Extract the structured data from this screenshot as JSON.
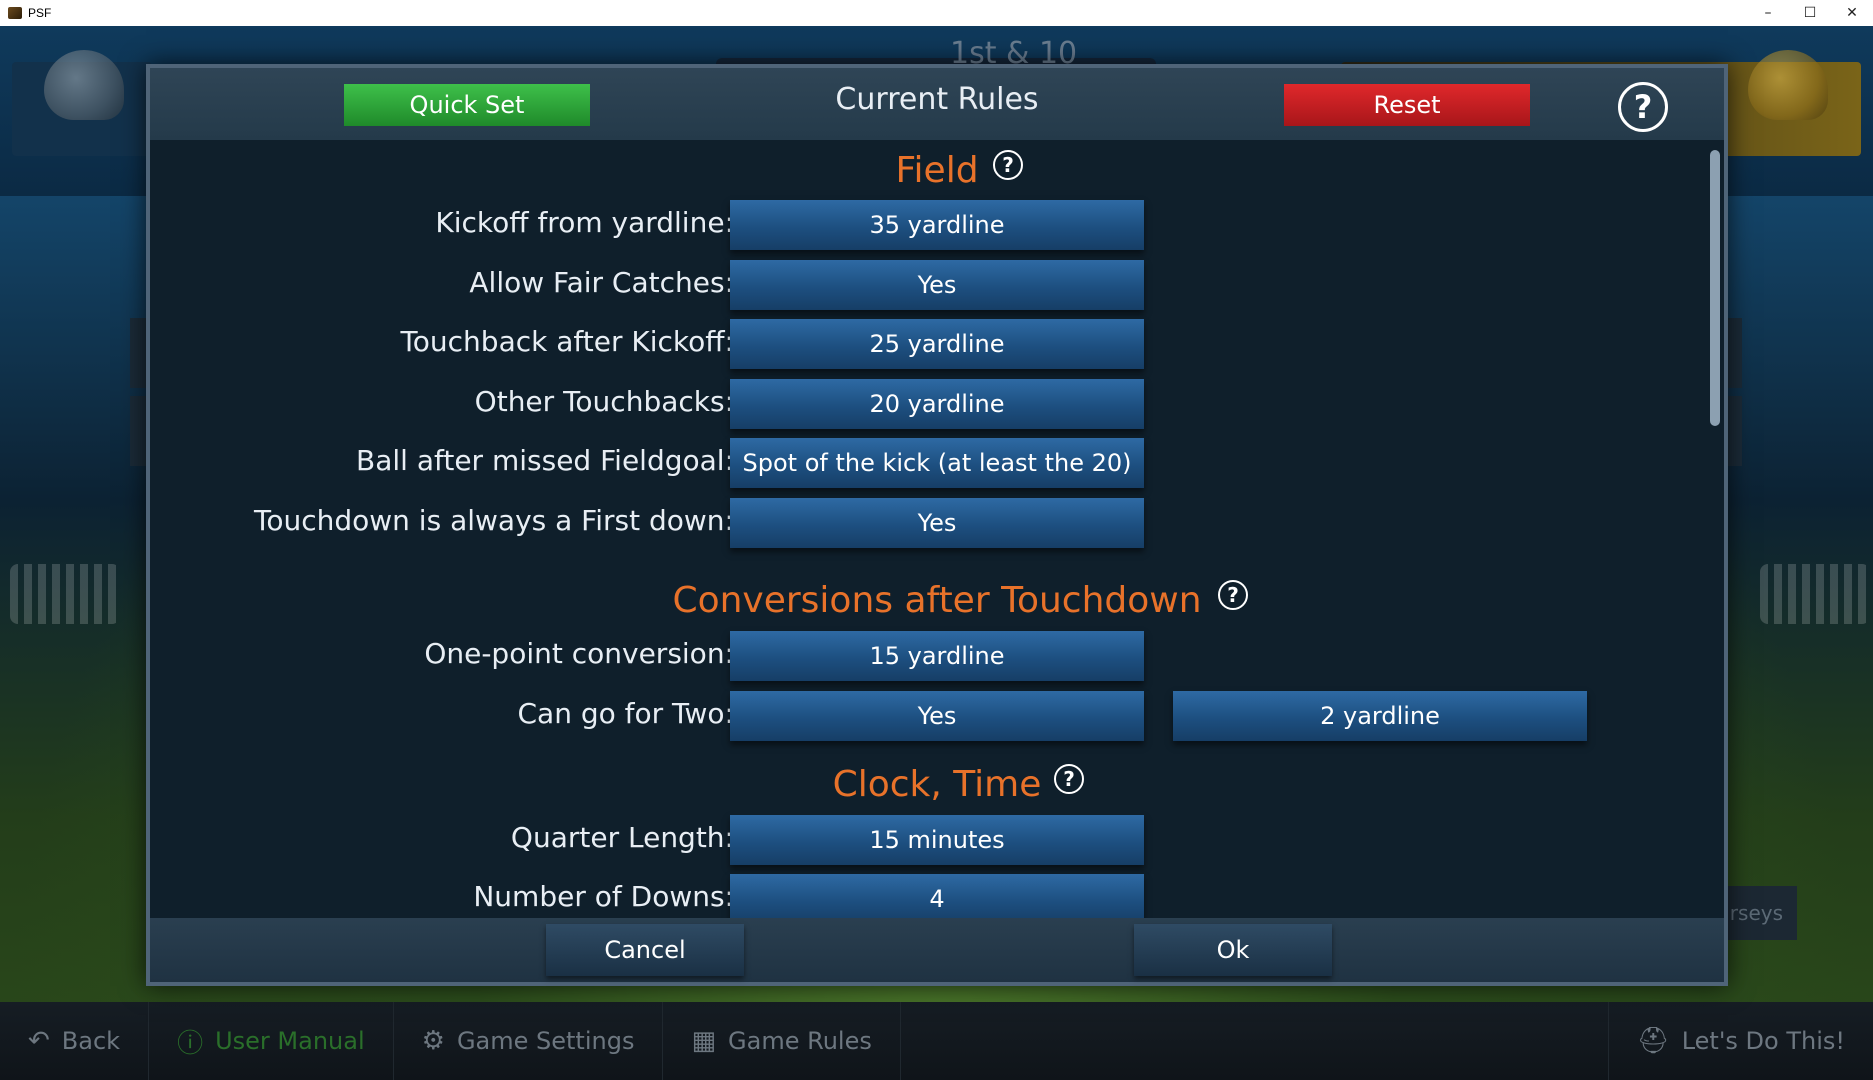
{
  "window": {
    "title": "PSF",
    "minimize": "–",
    "maximize": "☐",
    "close": "✕"
  },
  "background": {
    "scoreboard_text": "1st & 10",
    "jerseys_label": "rseys",
    "nav": [
      {
        "label": "Back",
        "icon": "back-arrow-icon"
      },
      {
        "label": "User Manual",
        "icon": "info-icon"
      },
      {
        "label": "Game Settings",
        "icon": "gear-icon"
      },
      {
        "label": "Game Rules",
        "icon": "scoreboard-icon"
      },
      {
        "label": "Let's Do This!",
        "icon": "helmet-icon"
      }
    ]
  },
  "dialog": {
    "title": "Current Rules",
    "quick_set": "Quick Set",
    "reset": "Reset",
    "help": "?",
    "cancel": "Cancel",
    "ok": "Ok",
    "colors": {
      "quick_set": "#2ea83a",
      "reset": "#c81f22",
      "section_title": "#e8722a",
      "value_button": "#2360a0"
    },
    "sections": {
      "field": {
        "title": "Field",
        "rows": [
          {
            "label": "Kickoff from yardline:",
            "value": "35 yardline"
          },
          {
            "label": "Allow Fair Catches:",
            "value": "Yes"
          },
          {
            "label": "Touchback after Kickoff:",
            "value": "25 yardline"
          },
          {
            "label": "Other Touchbacks:",
            "value": "20 yardline"
          },
          {
            "label": "Ball after missed Fieldgoal:",
            "value": "Spot of the kick (at least the 20)"
          },
          {
            "label": "Touchdown is always a First down:",
            "value": "Yes"
          }
        ]
      },
      "conversions": {
        "title": "Conversions after Touchdown",
        "rows": [
          {
            "label": "One-point conversion:",
            "value": "15 yardline"
          },
          {
            "label": "Can go for Two:",
            "value": "Yes",
            "value2": "2 yardline"
          }
        ]
      },
      "clock": {
        "title": "Clock, Time",
        "rows": [
          {
            "label": "Quarter Length:",
            "value": "15 minutes"
          },
          {
            "label": "Number of Downs:",
            "value": "4"
          }
        ]
      }
    }
  }
}
